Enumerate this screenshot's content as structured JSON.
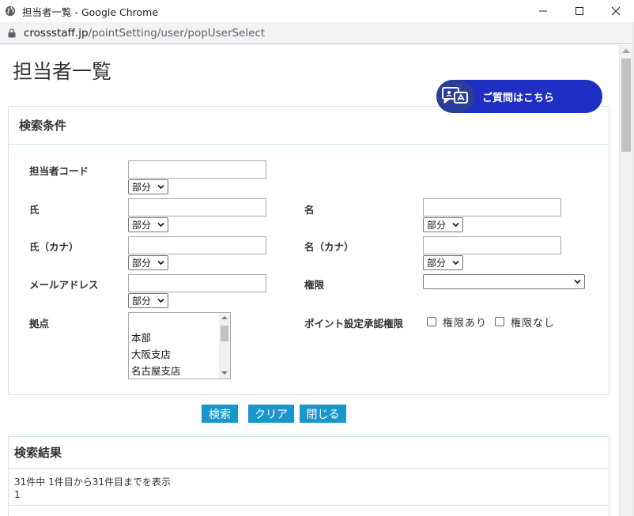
{
  "window": {
    "title": "担当者一覧 - Google Chrome",
    "url_host": "crossstaff.jp",
    "url_path": "/pointSetting/user/popUserSelect"
  },
  "page": {
    "title": "担当者一覧",
    "help_button": "ご質問はこちら"
  },
  "search": {
    "heading": "検索条件",
    "fields": {
      "code_label": "担当者コード",
      "sei_label": "氏",
      "mei_label": "名",
      "sei_kana_label": "氏（カナ）",
      "mei_kana_label": "名（カナ）",
      "email_label": "メールアドレス",
      "role_label": "権限",
      "base_label": "拠点",
      "point_approval_label": "ポイント設定承認権限"
    },
    "match_option": "部分",
    "role_value": "",
    "base_options": [
      "",
      "本部",
      "大阪支店",
      "名古屋支店"
    ],
    "checkboxes": [
      {
        "label": "権限あり",
        "checked": false
      },
      {
        "label": "権限なし",
        "checked": false
      }
    ],
    "buttons": {
      "search": "検索",
      "clear": "クリア",
      "close": "閉じる"
    }
  },
  "results": {
    "heading": "検索結果",
    "summary": "31件中 1件目から31件目までを表示",
    "page": "1"
  }
}
